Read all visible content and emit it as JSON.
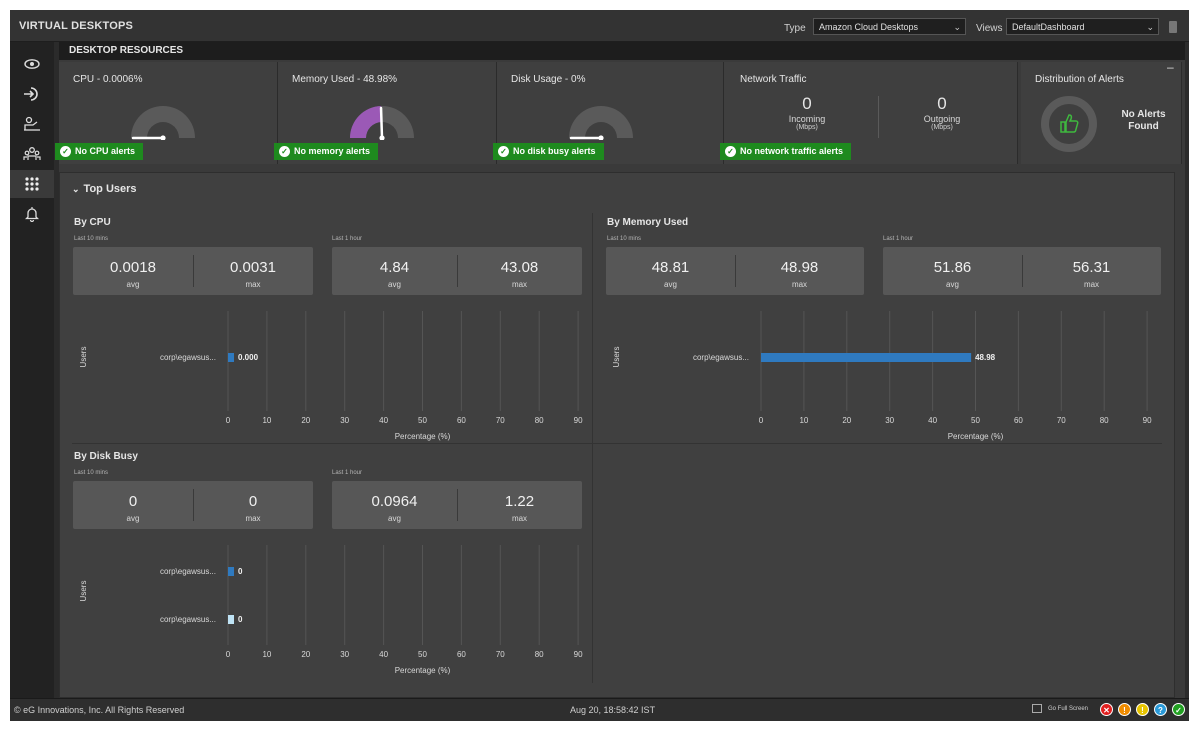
{
  "header": {
    "title": "VIRTUAL DESKTOPS",
    "type_label": "Type",
    "type_value": "Amazon Cloud Desktops",
    "views_label": "Views",
    "views_value": "DefaultDashboard"
  },
  "sidebar": {
    "items": [
      {
        "icon": "eye-icon"
      },
      {
        "icon": "sign-in-icon"
      },
      {
        "icon": "user-desk-icon"
      },
      {
        "icon": "users-group-icon"
      },
      {
        "icon": "grid-apps-icon",
        "active": true
      },
      {
        "icon": "bell-icon"
      }
    ]
  },
  "section_title": "DESKTOP RESOURCES",
  "cards": {
    "cpu": {
      "title": "CPU - 0.0006%",
      "badge": "No CPU alerts",
      "gauge_fraction": 6e-06
    },
    "memory": {
      "title": "Memory Used - 48.98%",
      "badge": "No memory alerts",
      "gauge_fraction": 0.4898
    },
    "disk": {
      "title": "Disk Usage - 0%",
      "badge": "No disk busy alerts",
      "gauge_fraction": 0
    },
    "network": {
      "title": "Network Traffic",
      "badge": "No network traffic alerts",
      "incoming_value": "0",
      "incoming_label": "Incoming",
      "incoming_unit": "(Mbps)",
      "outgoing_value": "0",
      "outgoing_label": "Outgoing",
      "outgoing_unit": "(Mbps)"
    },
    "alerts": {
      "title": "Distribution of Alerts",
      "message_line1": "No Alerts",
      "message_line2": "Found",
      "collapse_symbol": "–"
    }
  },
  "top_users": {
    "title": "Top Users",
    "by_cpu": {
      "title": "By CPU",
      "period1": "Last 10 mins",
      "avg1": "0.0018",
      "max1": "0.0031",
      "period2": "Last 1 hour",
      "avg2": "4.84",
      "max2": "43.08"
    },
    "by_memory": {
      "title": "By Memory Used",
      "period1": "Last 10 mins",
      "avg1": "48.81",
      "max1": "48.98",
      "period2": "Last 1 hour",
      "avg2": "51.86",
      "max2": "56.31"
    },
    "by_disk": {
      "title": "By Disk Busy",
      "period1": "Last 10 mins",
      "avg1": "0",
      "max1": "0",
      "period2": "Last 1 hour",
      "avg2": "0.0964",
      "max2": "1.22"
    },
    "avg_label": "avg",
    "max_label": "max"
  },
  "chart_data": [
    {
      "type": "bar",
      "orientation": "horizontal",
      "title": "By CPU",
      "categories": [
        "corp\\egawsus..."
      ],
      "values": [
        0.0006
      ],
      "data_labels": [
        "0.000"
      ],
      "xlabel": "Percentage (%)",
      "ylabel": "Users",
      "xlim": [
        0,
        100
      ],
      "xticks": [
        "0",
        "10",
        "20",
        "30",
        "40",
        "50",
        "60",
        "70",
        "80",
        "90",
        "100"
      ],
      "bar_color": "#2f7ac0"
    },
    {
      "type": "bar",
      "orientation": "horizontal",
      "title": "By Memory Used",
      "categories": [
        "corp\\egawsus..."
      ],
      "values": [
        48.98
      ],
      "data_labels": [
        "48.98"
      ],
      "xlabel": "Percentage (%)",
      "ylabel": "Users",
      "xlim": [
        0,
        100
      ],
      "xticks": [
        "0",
        "10",
        "20",
        "30",
        "40",
        "50",
        "60",
        "70",
        "80",
        "90",
        "100"
      ],
      "bar_color": "#2f7ac0"
    },
    {
      "type": "bar",
      "orientation": "horizontal",
      "title": "By Disk Busy",
      "categories": [
        "corp\\egawsus...",
        "corp\\egawsus..."
      ],
      "values": [
        0,
        0
      ],
      "data_labels": [
        "0",
        "0"
      ],
      "xlabel": "Percentage (%)",
      "ylabel": "Users",
      "xlim": [
        0,
        100
      ],
      "xticks": [
        "0",
        "10",
        "20",
        "30",
        "40",
        "50",
        "60",
        "70",
        "80",
        "90",
        "100"
      ],
      "bar_colors": [
        "#2f7ac0",
        "#bfe3f5"
      ]
    }
  ],
  "footer": {
    "copyright": "© eG Innovations, Inc. All Rights Reserved",
    "timestamp": "Aug 20, 18:58:42 IST",
    "fullscreen_label": "Go Full Screen",
    "status_icons": [
      {
        "name": "critical-icon",
        "symbol": "✕",
        "color": "#e02020"
      },
      {
        "name": "major-icon",
        "symbol": "!",
        "color": "#f08c00"
      },
      {
        "name": "minor-icon",
        "symbol": "!",
        "color": "#e6c400"
      },
      {
        "name": "unknown-icon",
        "symbol": "?",
        "color": "#2a9ad8"
      },
      {
        "name": "normal-icon",
        "symbol": "✓",
        "color": "#22a022"
      }
    ]
  },
  "colors": {
    "accent_green": "#1e8a1e",
    "gauge_fill": "#9b59b6",
    "bar_blue": "#2f7ac0"
  }
}
